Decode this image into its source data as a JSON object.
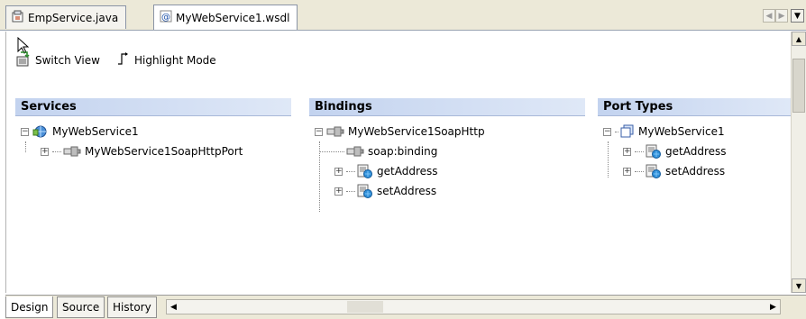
{
  "tabs": [
    {
      "label": "EmpService.java",
      "icon": "java-file-icon",
      "active": false
    },
    {
      "label": "MyWebService1.wsdl",
      "icon": "wsdl-file-icon",
      "active": true
    }
  ],
  "toolbar": {
    "switch_view": "Switch View",
    "highlight_mode": "Highlight Mode"
  },
  "services": {
    "header": "Services",
    "root": "MyWebService1",
    "child": "MyWebService1SoapHttpPort"
  },
  "bindings": {
    "header": "Bindings",
    "root": "MyWebService1SoapHttp",
    "items": [
      "soap:binding",
      "getAddress",
      "setAddress"
    ]
  },
  "port_types": {
    "header": "Port Types",
    "root": "MyWebService1",
    "items": [
      "getAddress",
      "setAddress"
    ]
  },
  "bottom_tabs": [
    {
      "label": "Design",
      "active": true
    },
    {
      "label": "Source",
      "active": false
    },
    {
      "label": "History",
      "active": false
    }
  ],
  "colors": {
    "header_gradient_start": "#c3d3ef",
    "header_gradient_end": "#dfe8f7",
    "chrome": "#ece9d8"
  }
}
